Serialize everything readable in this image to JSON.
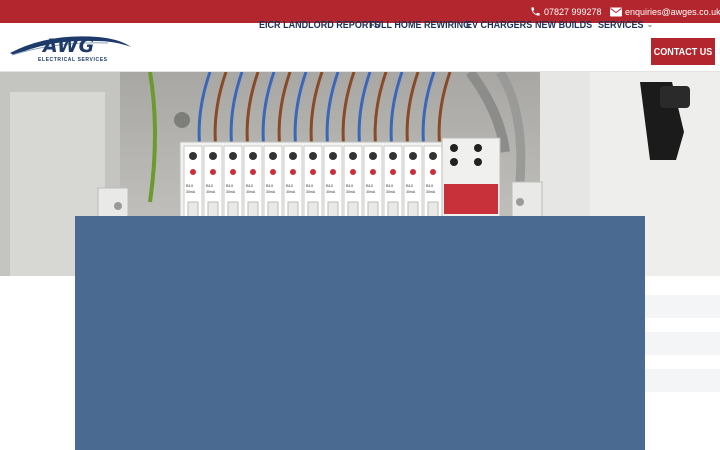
{
  "topbar": {
    "phone": "07827 999278",
    "email": "enquiries@awges.co.uk",
    "phone_icon": "phone-icon",
    "email_icon": "envelope-icon"
  },
  "logo": {
    "wordmark": "AWG",
    "tagline": "ELECTRICAL SERVICES"
  },
  "nav": {
    "items": [
      {
        "label": "EICR Landlord Reports"
      },
      {
        "label": "Full Home Rewiring"
      },
      {
        "label": "EV Chargers"
      },
      {
        "label": "New Builds"
      },
      {
        "label": "Services"
      }
    ],
    "cta_label": "Contact Us"
  },
  "hero": {
    "breaker_labels": [
      "B10",
      "B10",
      "B10",
      "B10",
      "B10",
      "B10",
      "B10",
      "B10",
      "B10",
      "B10",
      "B10",
      "B10",
      "B10"
    ],
    "rcd_label": "30mA"
  },
  "colors": {
    "brand_red": "#b3262e",
    "brand_navy": "#1f3157",
    "panel_blue": "#4a6a91"
  }
}
